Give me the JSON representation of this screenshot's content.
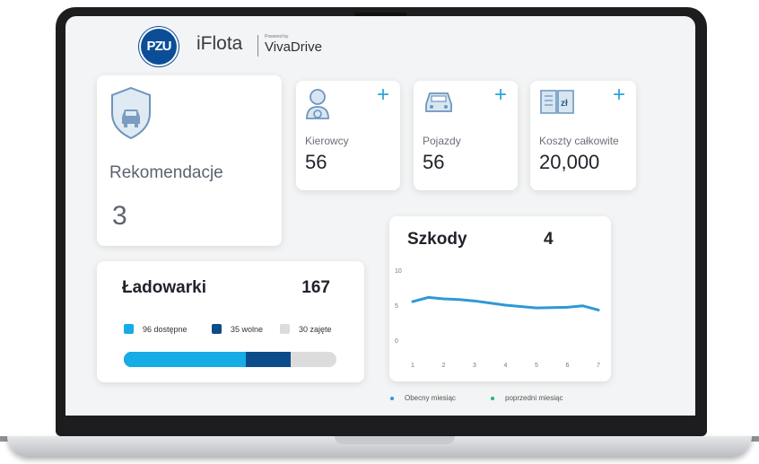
{
  "header": {
    "logo_text": "PZU",
    "app_name": "iFlota",
    "powered_by": "Powered by",
    "partner": "VivaDrive"
  },
  "recommendations": {
    "icon": "shield-car-icon",
    "title": "Rekomendacje",
    "value": "3"
  },
  "stats": {
    "drivers": {
      "icon": "driver-icon",
      "label": "Kierowcy",
      "value": "56",
      "add": "+"
    },
    "vehicles": {
      "icon": "car-icon",
      "label": "Pojazdy",
      "value": "56",
      "add": "+"
    },
    "costs": {
      "icon": "cost-book-icon",
      "label": "Koszty całkowite",
      "value": "20,000",
      "add": "+",
      "icon_text": "zł"
    }
  },
  "chargers": {
    "title": "Ładowarki",
    "total": "167",
    "legend": [
      {
        "label": "96 dostępne",
        "color": "#16ace6"
      },
      {
        "label": "35 wolne",
        "color": "#0c4c8a"
      },
      {
        "label": "30 zajęte",
        "color": "#dcdcdc"
      }
    ],
    "bar_fraction": {
      "available": 0.5749,
      "free": 0.2096
    }
  },
  "damages": {
    "title": "Szkody",
    "count": "4"
  },
  "chart_data": {
    "type": "line",
    "x": [
      1,
      2,
      3,
      4,
      5,
      6,
      7
    ],
    "ylim": [
      0,
      10
    ],
    "y_ticks": [
      "0",
      "5",
      "10"
    ],
    "x_ticks": [
      "1",
      "2",
      "3",
      "4",
      "5",
      "6",
      "7"
    ],
    "series": [
      {
        "name": "Obecny miesiąc",
        "color": "#2f98d6",
        "x": [
          1,
          1.5,
          2,
          2.5,
          3,
          4,
          5,
          6,
          6.5,
          7
        ],
        "values": [
          5.5,
          6.1,
          5.9,
          5.8,
          5.6,
          5.0,
          4.6,
          4.7,
          4.9,
          4.3
        ]
      }
    ],
    "legend": [
      {
        "label": "Obecny miesiąc",
        "color": "#2f98d6"
      },
      {
        "label": "poprzedni miesiąc",
        "color": "#22b573"
      }
    ]
  }
}
